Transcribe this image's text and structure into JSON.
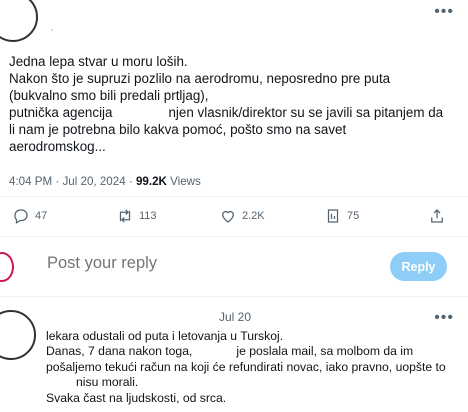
{
  "tweet": {
    "more_icon": "more-horizontal-icon",
    "body": {
      "line1": "Jedna lepa stvar u moru loših.",
      "line2": "Nakon što je supruzi pozlilo na aerodromu, neposredno pre puta",
      "line3": "(bukvalno smo bili predali prtljag),",
      "line4a": "putnička agencija",
      "line4b": "njen vlasnik/direktor su se javili sa pitanjem da",
      "line5": "li nam je potrebna bilo kakva pomoć, pošto smo na savet",
      "line6": "aerodromskog..."
    },
    "meta": {
      "time": "4:04 PM · Jul 20, 2024 · ",
      "views_count": "99.2K",
      "views_label": " Views"
    },
    "actions": {
      "replies": "47",
      "reposts": "113",
      "likes": "2.2K",
      "bookmarks": "75"
    }
  },
  "reply_composer": {
    "placeholder": "Post your reply",
    "button_label": "Reply"
  },
  "reply_tweet": {
    "date": "Jul 20",
    "body": {
      "line1": "lekara odustali od puta i letovanja u Turskoj.",
      "line2a": "Danas, 7 dana nakon toga,",
      "line2b": "je poslala mail, sa molbom da im",
      "line3": "pošaljemo tekući račun na koji će refundirati novac, iako pravno, uopšte to",
      "line4": "nisu morali.",
      "line5": "Svaka čast na ljudskosti, od srca."
    }
  }
}
